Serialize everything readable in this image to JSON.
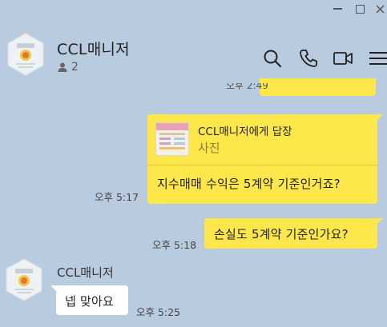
{
  "window": {
    "controls": [
      "minimize-icon",
      "maximize-icon",
      "close-icon"
    ]
  },
  "header": {
    "title": "CCL매니저",
    "member_count": "2",
    "icons": [
      "search-icon",
      "phone-icon",
      "video-icon",
      "menu-icon"
    ]
  },
  "messages": {
    "previous_time": "오후 2:49",
    "reply": {
      "quoted_title": "CCL매니저에게 답장",
      "quoted_type": "사진",
      "text": "지수매매 수익은 5계약 기준인거죠?",
      "time": "오후 5:17"
    },
    "second": {
      "text": "손실도 5계약 기준인가요?",
      "time": "오후 5:18"
    },
    "incoming": {
      "sender": "CCL매니저",
      "text": "넵 맞아요",
      "time": "오후 5:25"
    }
  },
  "colors": {
    "background": "#b9cbdf",
    "my_bubble": "#fde74a",
    "their_bubble": "#ffffff"
  }
}
